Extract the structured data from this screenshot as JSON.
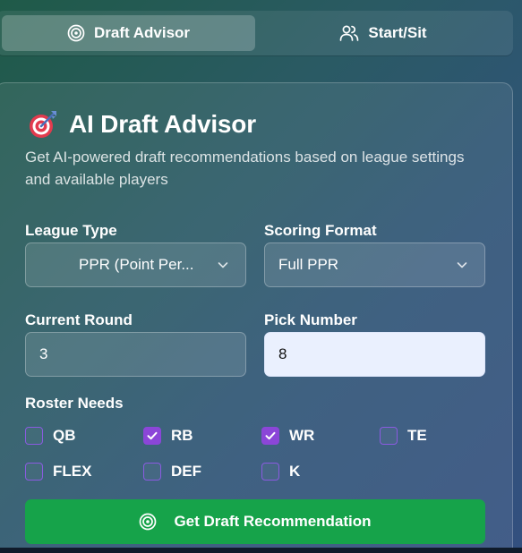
{
  "tabs": [
    {
      "label": "Draft Advisor",
      "icon": "target-icon",
      "active": true
    },
    {
      "label": "Start/Sit",
      "icon": "users-icon",
      "active": false
    }
  ],
  "card": {
    "title": "AI Draft Advisor",
    "title_icon": "dart-target-icon",
    "subtitle": "Get AI-powered draft recommendations based on league settings and available players"
  },
  "form": {
    "league_type": {
      "label": "League Type",
      "value": "PPR (Point Per..."
    },
    "scoring_format": {
      "label": "Scoring Format",
      "value": "Full PPR"
    },
    "current_round": {
      "label": "Current Round",
      "value": "3"
    },
    "pick_number": {
      "label": "Pick Number",
      "value": "8"
    }
  },
  "roster_needs": {
    "label": "Roster Needs",
    "options": [
      {
        "label": "QB",
        "checked": false
      },
      {
        "label": "RB",
        "checked": true
      },
      {
        "label": "WR",
        "checked": true
      },
      {
        "label": "TE",
        "checked": false
      },
      {
        "label": "FLEX",
        "checked": false
      },
      {
        "label": "DEF",
        "checked": false
      },
      {
        "label": "K",
        "checked": false
      }
    ]
  },
  "cta": {
    "label": "Get Draft Recommendation",
    "icon": "target-icon"
  },
  "colors": {
    "accent_purple": "#8b46d8",
    "cta_green": "#16a34a",
    "focused_input": "#eaf0fe"
  }
}
